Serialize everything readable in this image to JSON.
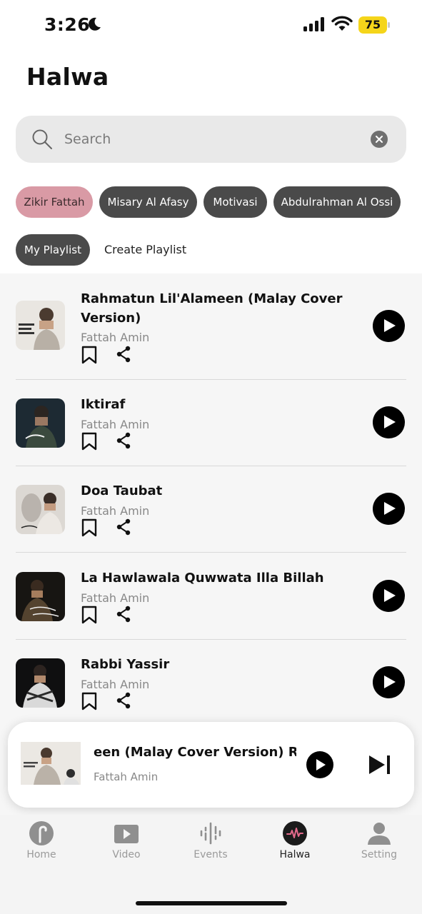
{
  "status_bar": {
    "time": "3:26",
    "battery": "75"
  },
  "header": {
    "title": "Halwa"
  },
  "search": {
    "placeholder": "Search"
  },
  "chips": [
    "Zikir Fattah",
    "Misary Al Afasy",
    "Motivasi",
    "Abdulrahman Al Ossi"
  ],
  "playlist": {
    "my_playlist": "My Playlist",
    "create": "Create Playlist"
  },
  "tracks": [
    {
      "title": "Rahmatun Lil'Alameen (Malay Cover Version)",
      "artist": "Fattah Amin"
    },
    {
      "title": "Iktiraf",
      "artist": "Fattah Amin"
    },
    {
      "title": "Doa Taubat",
      "artist": "Fattah Amin"
    },
    {
      "title": "La Hawlawala Quwwata Illa Billah",
      "artist": "Fattah Amin"
    },
    {
      "title": "Rabbi Yassir",
      "artist": "Fattah Amin"
    }
  ],
  "now_playing": {
    "title_visible": "een (Malay Cover Version) Ra",
    "artist": "Fattah Amin"
  },
  "tabs": [
    {
      "label": "Home",
      "icon": "home-icon"
    },
    {
      "label": "Video",
      "icon": "video-icon"
    },
    {
      "label": "Events",
      "icon": "events-icon"
    },
    {
      "label": "Halwa",
      "icon": "halwa-icon"
    },
    {
      "label": "Setting",
      "icon": "setting-icon"
    }
  ],
  "colors": {
    "active_chip": "#d99aa5",
    "chip": "#4a4a4a",
    "battery": "#f5d51a",
    "halwa_accent": "#e46a8c"
  }
}
